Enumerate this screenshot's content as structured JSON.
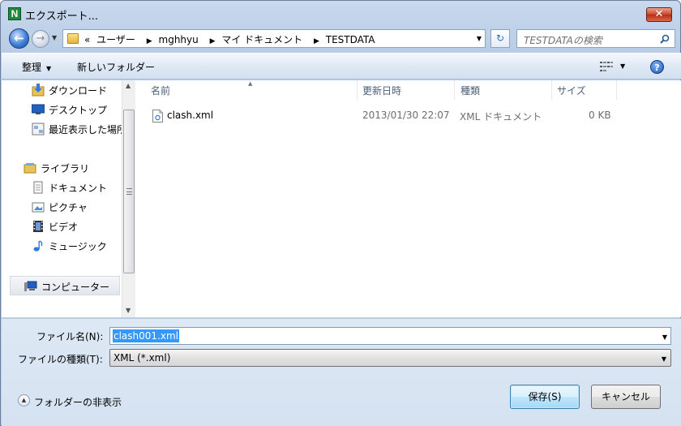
{
  "window": {
    "title": "エクスポート...",
    "app_icon_letter": "N",
    "close_symbol": "✕"
  },
  "nav": {
    "breadcrumb_overflow": "«",
    "breadcrumbs": [
      "ユーザー",
      "mghhyu",
      "マイ ドキュメント",
      "TESTDATA"
    ],
    "search_placeholder": "TESTDATAの検索"
  },
  "toolbar": {
    "organize_label": "整理",
    "new_folder_label": "新しいフォルダー"
  },
  "sidebar": {
    "favorites": [
      {
        "label": "ダウンロード",
        "icon": "download-folder-icon"
      },
      {
        "label": "デスクトップ",
        "icon": "desktop-icon"
      },
      {
        "label": "最近表示した場所",
        "icon": "recent-places-icon"
      }
    ],
    "libraries_label": "ライブラリ",
    "libraries": [
      {
        "label": "ドキュメント",
        "icon": "documents-icon"
      },
      {
        "label": "ピクチャ",
        "icon": "pictures-icon"
      },
      {
        "label": "ビデオ",
        "icon": "video-icon"
      },
      {
        "label": "ミュージック",
        "icon": "music-icon"
      }
    ],
    "computer_label": "コンピューター"
  },
  "file_list": {
    "columns": [
      "名前",
      "更新日時",
      "種類",
      "サイズ"
    ],
    "rows": [
      {
        "name": "clash.xml",
        "modified": "2013/01/30 22:07",
        "type": "XML ドキュメント",
        "size": "0 KB"
      }
    ]
  },
  "form": {
    "filename_label": "ファイル名(N):",
    "filename_value": "clash001.xml",
    "filetype_label": "ファイルの種類(T):",
    "filetype_value": "XML (*.xml)",
    "hide_folders_label": "フォルダーの非表示",
    "save_label": "保存(S)",
    "cancel_label": "キャンセル"
  },
  "colors": {
    "selection": "#3399ff",
    "column_header_text": "#4c607a",
    "file_meta_text": "#6d6d6d"
  }
}
